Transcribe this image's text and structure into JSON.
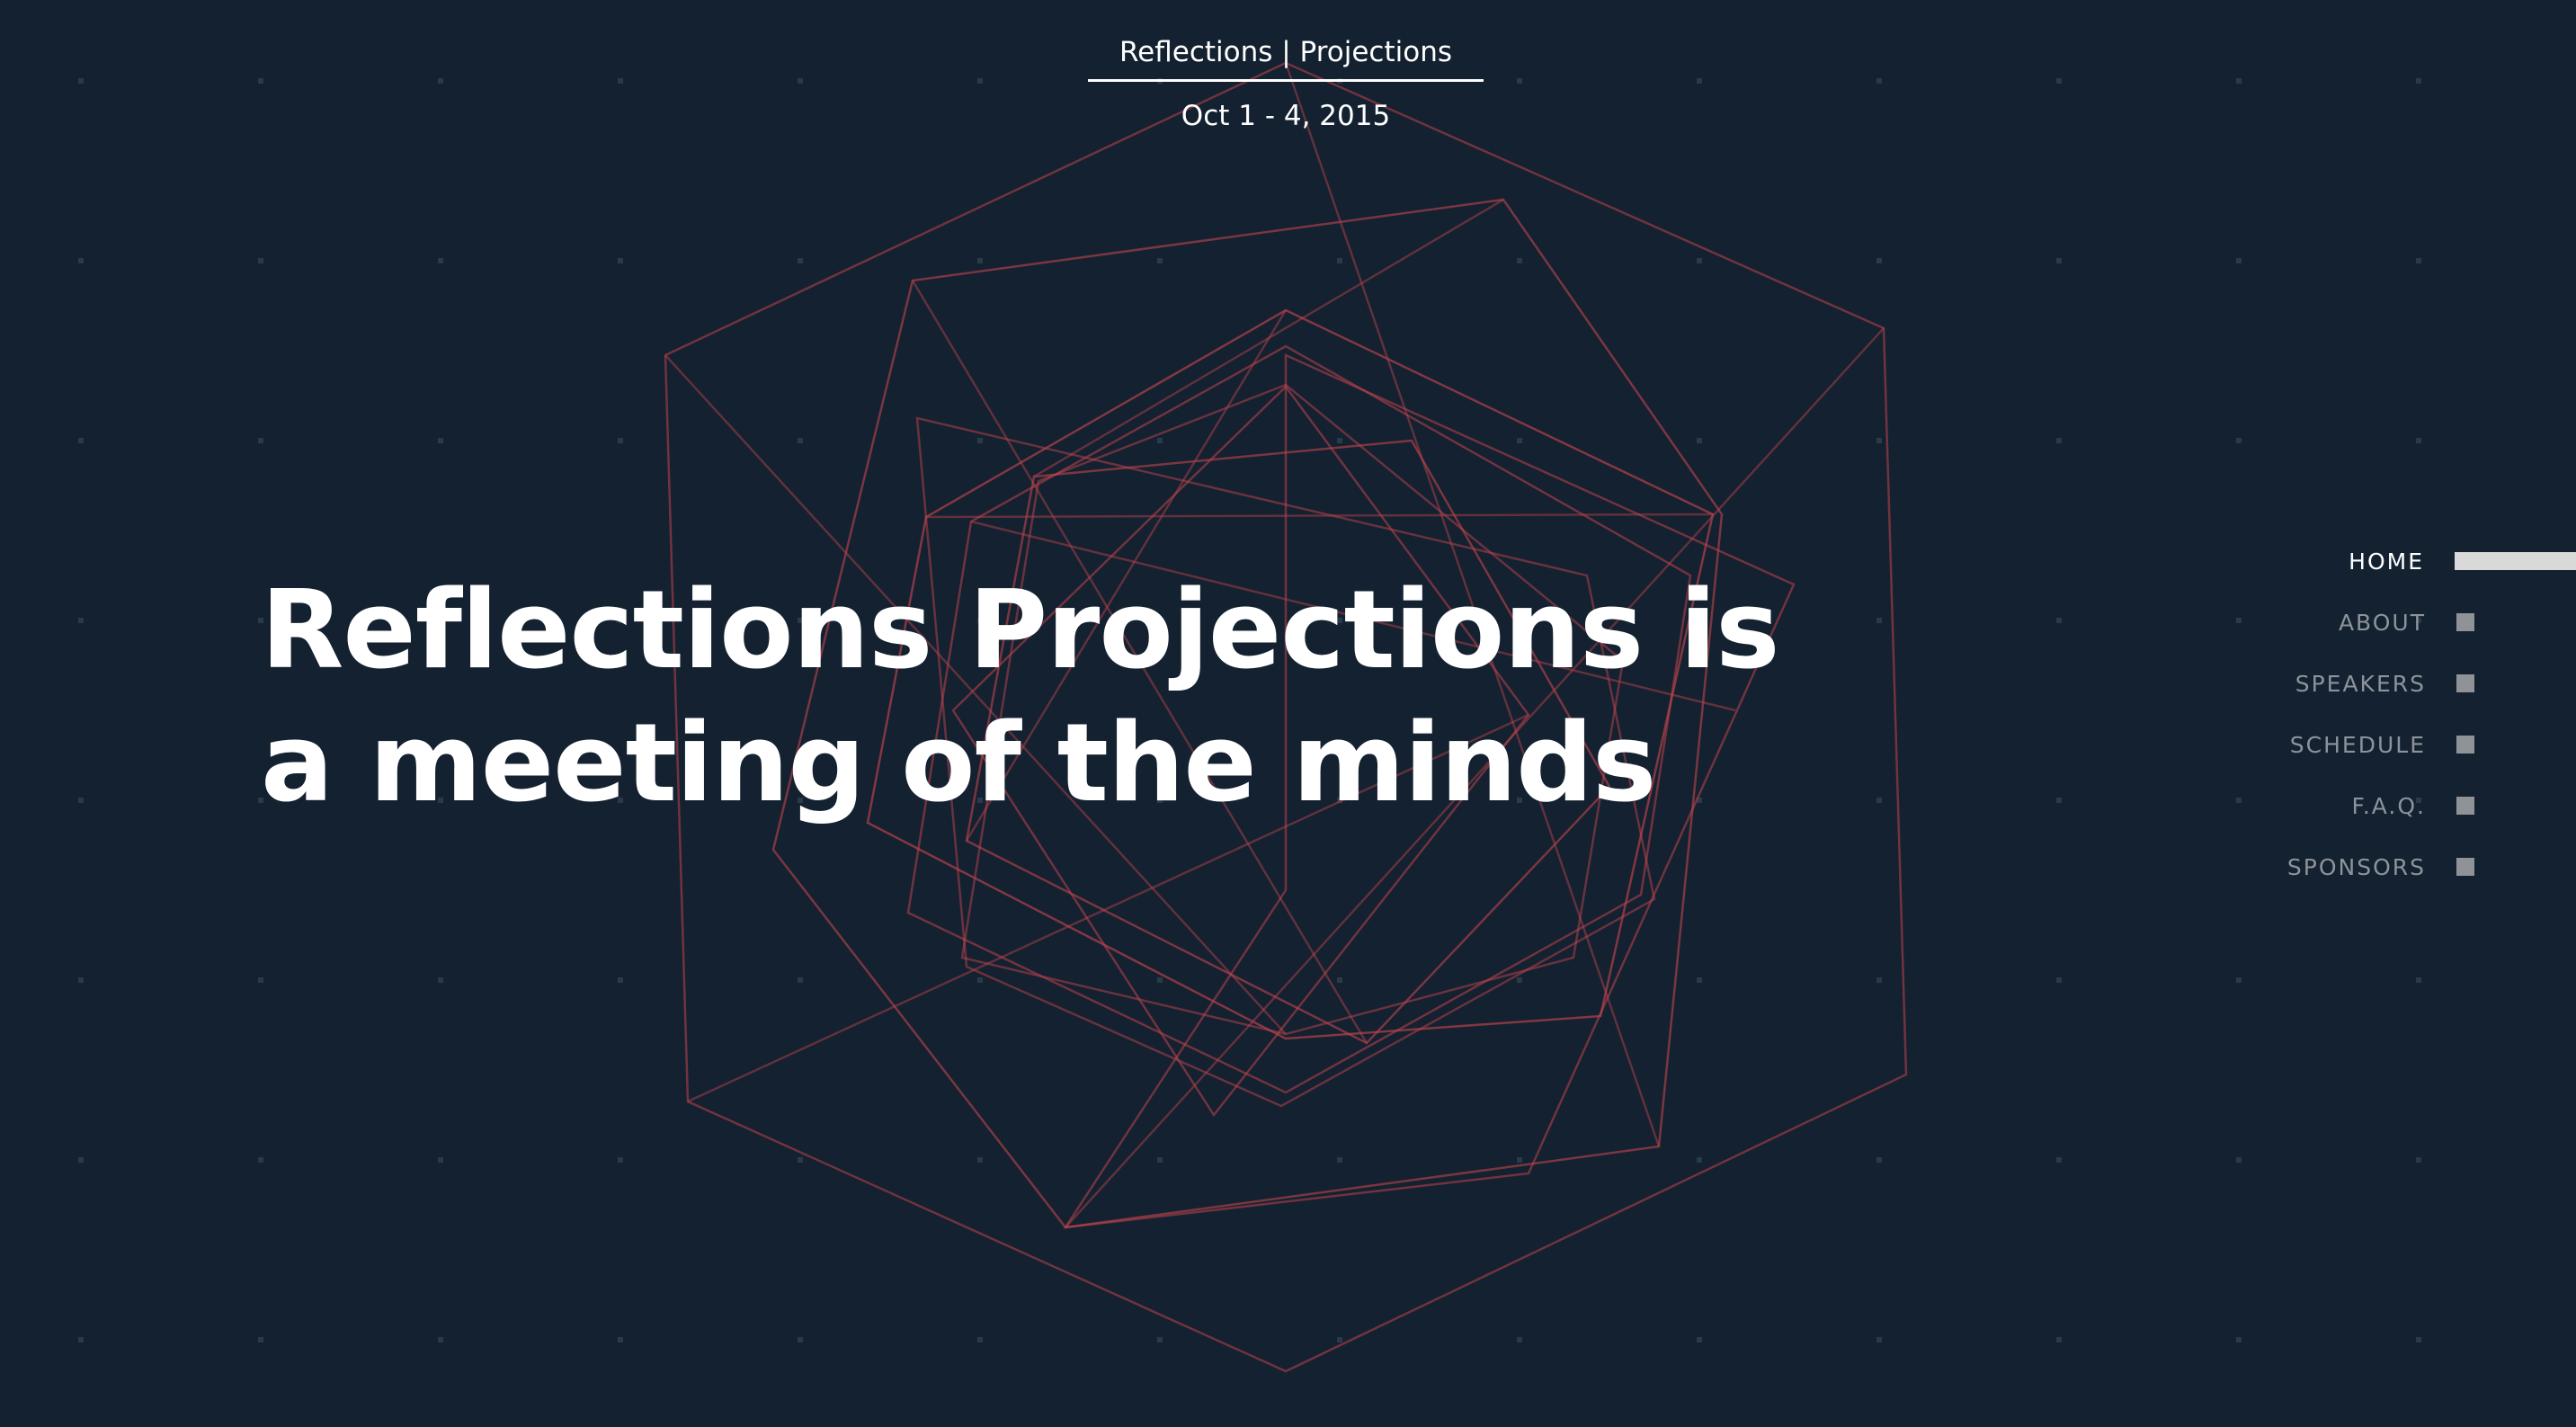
{
  "header": {
    "brand": "Reflections | Projections",
    "dates": "Oct 1 - 4, 2015"
  },
  "hero": {
    "line1": "Reflections Projections is",
    "line2": "a meeting of the minds"
  },
  "nav": {
    "items": [
      {
        "label": "HOME",
        "active": true
      },
      {
        "label": "ABOUT",
        "active": false
      },
      {
        "label": "SPEAKERS",
        "active": false
      },
      {
        "label": "SCHEDULE",
        "active": false
      },
      {
        "label": "F.A.Q.",
        "active": false
      },
      {
        "label": "SPONSORS",
        "active": false
      }
    ]
  },
  "colors": {
    "background": "#132130",
    "line": "#c0444d",
    "dot": "#2b3a48",
    "text": "#ffffff",
    "nav_inactive": "#8d939b",
    "nav_active_bar": "#d9d9d9"
  }
}
